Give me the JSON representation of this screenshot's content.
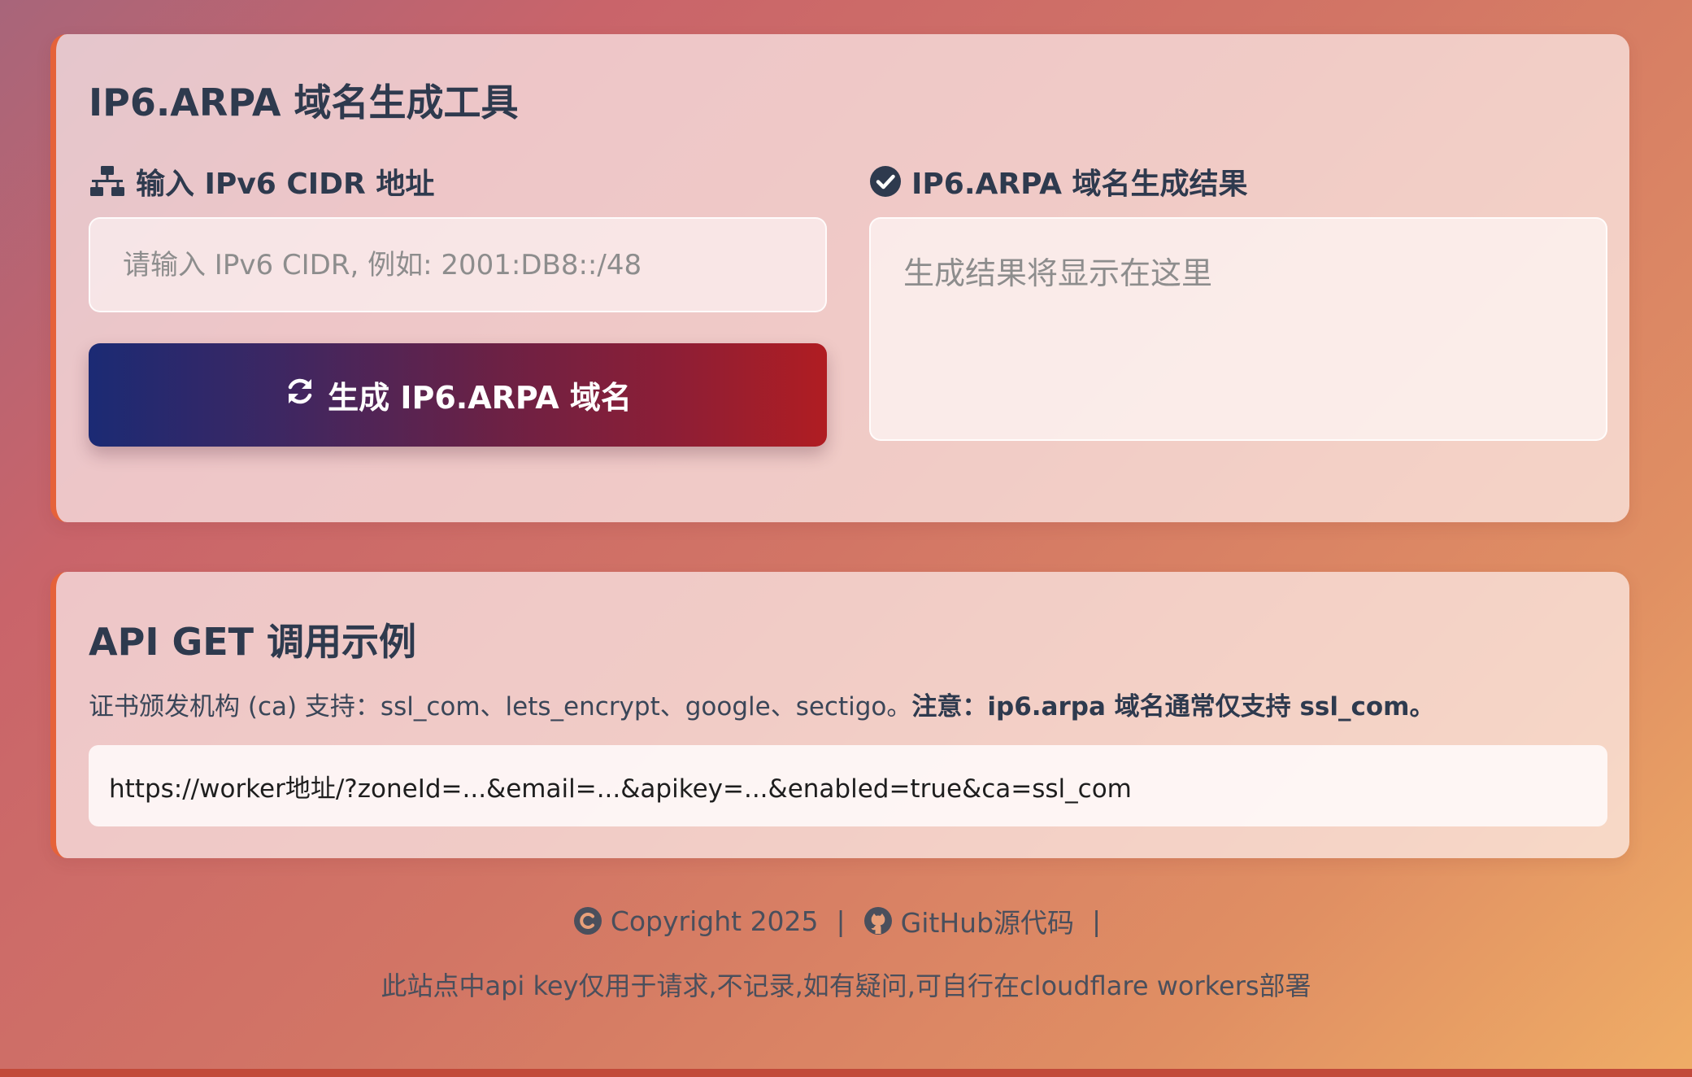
{
  "tool": {
    "title": "IP6.ARPA 域名生成工具",
    "input_label": "输入 IPv6 CIDR 地址",
    "input_placeholder": "请输入 IPv6 CIDR, 例如: 2001:DB8::/48",
    "input_value": "",
    "generate_button": "生成 IP6.ARPA 域名",
    "result_label": "IP6.ARPA 域名生成结果",
    "result_placeholder": "生成结果将显示在这里"
  },
  "api": {
    "title": "API GET 调用示例",
    "desc_text": "证书颁发机构 (ca) 支持：ssl_com、lets_encrypt、google、sectigo。",
    "desc_note": "注意：ip6.arpa 域名通常仅支持 ssl_com。",
    "example_url": "https://worker地址/?zoneId=...&email=...&apikey=...&enabled=true&ca=ssl_com"
  },
  "footer": {
    "copyright": "Copyright 2025",
    "separator": "|",
    "github_link": "GitHub源代码",
    "notice": "此站点中api key仅用于请求,不记录,如有疑问,可自行在cloudflare workers部署"
  },
  "icons": {
    "input_label_icon": "network-icon",
    "result_label_icon": "check-circle-icon",
    "button_icon": "refresh-icon",
    "copyright_icon": "copyright-icon",
    "github_icon": "github-icon"
  },
  "colors": {
    "button_gradient_start": "#1b2a74",
    "button_gradient_end": "#b01d22",
    "card_accent": "#e5623a",
    "heading_text": "#2e3a4e"
  }
}
